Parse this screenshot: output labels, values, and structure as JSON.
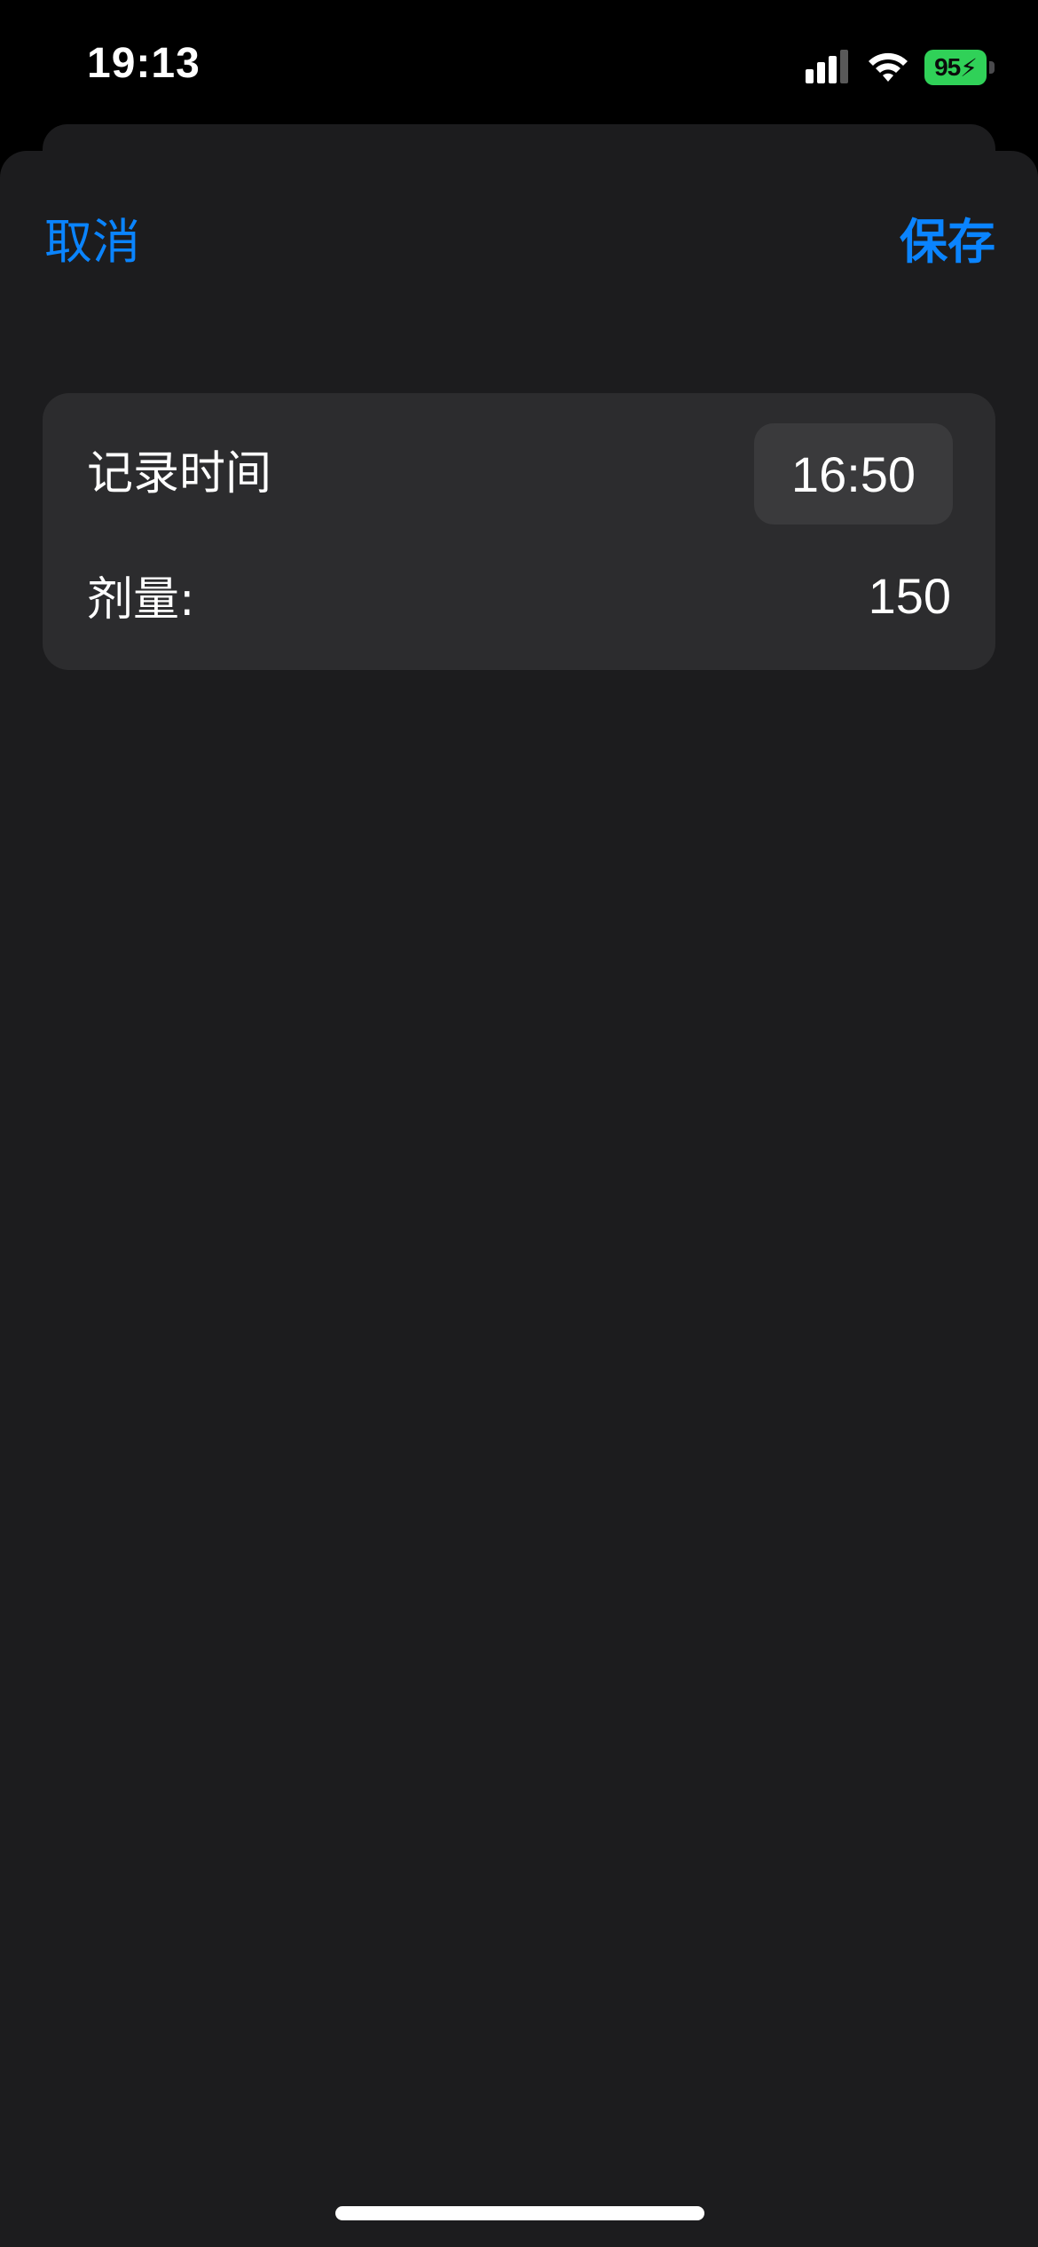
{
  "status_bar": {
    "time": "19:13",
    "battery_level": "95",
    "battery_color": "#30d158",
    "signal_icon": "cellular-signal-icon",
    "wifi_icon": "wifi-icon"
  },
  "nav": {
    "cancel_label": "取消",
    "save_label": "保存",
    "accent_color": "#0a84ff"
  },
  "form": {
    "record_time_label": "记录时间",
    "record_time_value": "16:50",
    "dose_label": "剂量:",
    "dose_value": "150"
  }
}
